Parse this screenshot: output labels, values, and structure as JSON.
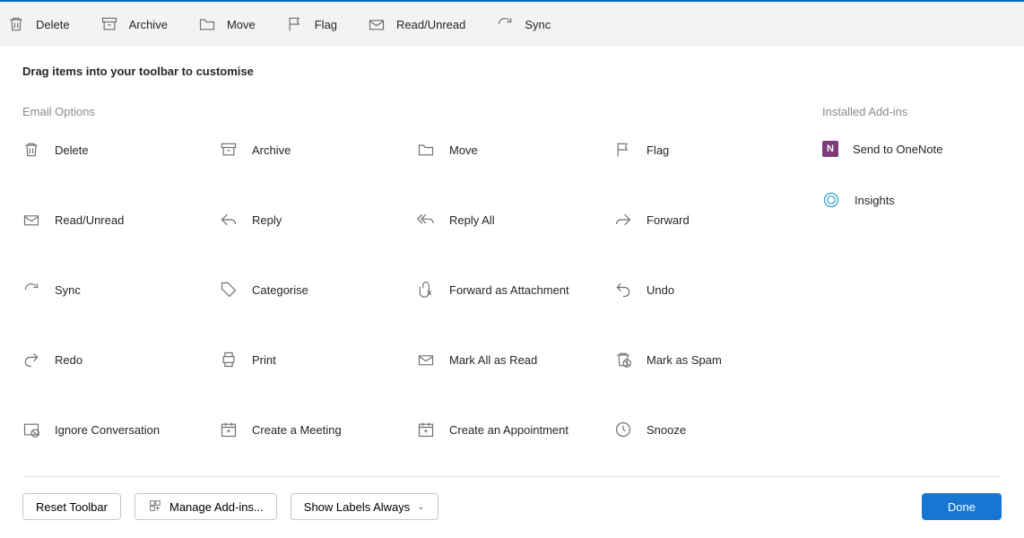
{
  "toolbar": [
    {
      "name": "delete",
      "label": "Delete",
      "icon": "trash"
    },
    {
      "name": "archive",
      "label": "Archive",
      "icon": "archive"
    },
    {
      "name": "move",
      "label": "Move",
      "icon": "folder"
    },
    {
      "name": "flag",
      "label": "Flag",
      "icon": "flag"
    },
    {
      "name": "readunread",
      "label": "Read/Unread",
      "icon": "envelope"
    },
    {
      "name": "sync",
      "label": "Sync",
      "icon": "sync"
    }
  ],
  "instruction": "Drag items into your toolbar to customise",
  "sections": {
    "email_options_title": "Email Options",
    "addins_title": "Installed Add-ins"
  },
  "options": [
    {
      "name": "delete",
      "label": "Delete",
      "icon": "trash"
    },
    {
      "name": "archive",
      "label": "Archive",
      "icon": "archive"
    },
    {
      "name": "move",
      "label": "Move",
      "icon": "folder"
    },
    {
      "name": "flag",
      "label": "Flag",
      "icon": "flag"
    },
    {
      "name": "readunread",
      "label": "Read/Unread",
      "icon": "envelope"
    },
    {
      "name": "reply",
      "label": "Reply",
      "icon": "reply"
    },
    {
      "name": "replyall",
      "label": "Reply All",
      "icon": "replyall"
    },
    {
      "name": "forward",
      "label": "Forward",
      "icon": "forward"
    },
    {
      "name": "sync",
      "label": "Sync",
      "icon": "sync"
    },
    {
      "name": "categorise",
      "label": "Categorise",
      "icon": "tag"
    },
    {
      "name": "forwardattach",
      "label": "Forward as Attachment",
      "icon": "attach"
    },
    {
      "name": "undo",
      "label": "Undo",
      "icon": "undo"
    },
    {
      "name": "redo",
      "label": "Redo",
      "icon": "redo"
    },
    {
      "name": "print",
      "label": "Print",
      "icon": "print"
    },
    {
      "name": "markallread",
      "label": "Mark All as Read",
      "icon": "envelope"
    },
    {
      "name": "markspam",
      "label": "Mark as Spam",
      "icon": "spam"
    },
    {
      "name": "ignoreconv",
      "label": "Ignore Conversation",
      "icon": "ignore"
    },
    {
      "name": "createmeeting",
      "label": "Create a Meeting",
      "icon": "meeting"
    },
    {
      "name": "createappt",
      "label": "Create an Appointment",
      "icon": "appointment"
    },
    {
      "name": "snooze",
      "label": "Snooze",
      "icon": "clock"
    }
  ],
  "addins": [
    {
      "name": "sendonenote",
      "label": "Send to OneNote",
      "icon": "onenote"
    },
    {
      "name": "insights",
      "label": "Insights",
      "icon": "insights"
    }
  ],
  "buttons": {
    "reset": "Reset Toolbar",
    "manage": "Manage Add-ins...",
    "showlabels": "Show Labels Always",
    "done": "Done"
  }
}
